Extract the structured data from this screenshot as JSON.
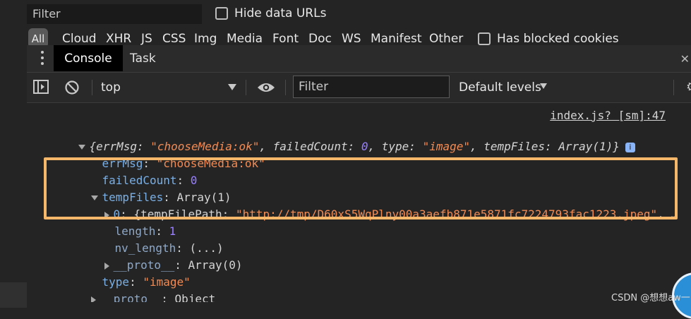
{
  "network": {
    "filter_placeholder": "Filter",
    "hide_data_urls_label": "Hide data URLs",
    "all_label": "All",
    "types": [
      "Cloud",
      "XHR",
      "JS",
      "CSS",
      "Img",
      "Media",
      "Font",
      "Doc",
      "WS",
      "Manifest",
      "Other"
    ],
    "blocked_cookies_label": "Has blocked cookies"
  },
  "tabs": {
    "console_label": "Console",
    "task_label": "Task"
  },
  "toolbar": {
    "context": "top",
    "filter_placeholder": "Filter",
    "levels_label": "Default levels"
  },
  "console": {
    "source_link": "index.js? [sm]:47",
    "lines": {
      "summary_open": "{",
      "summary_k1": "errMsg",
      "summary_v1": "\"chooseMedia:ok\"",
      "summary_k2": "failedCount",
      "summary_v2": "0",
      "summary_k3": "type",
      "summary_v3": "\"image\"",
      "summary_k4": "tempFiles",
      "summary_v4": "Array(1)",
      "summary_close": "}",
      "errMsg_key": "errMsg",
      "errMsg_val": "\"chooseMedia:ok\"",
      "failedCount_key": "failedCount",
      "failedCount_val": "0",
      "tempFiles_key": "tempFiles",
      "tempFiles_val": "Array(1)",
      "item0_key": "0",
      "item0_prefix": "{tempFilePath: ",
      "item0_val": "\"http://tmp/D60xS5WqPlny00a3aefb871e5871fc7224793fac1223.jpeg\"",
      "item0_more": ", …",
      "length_key": "length",
      "length_val": "1",
      "nvlength_key": "nv_length",
      "nvlength_val": "(...)",
      "proto_arr_key": "__proto__",
      "proto_arr_val": "Array(0)",
      "type_key": "type",
      "type_val": "\"image\"",
      "proto_obj_key": "__proto__",
      "proto_obj_val": "Object"
    }
  },
  "watermark": "CSDN @想想aw一",
  "colors": {
    "highlight": "#f5b86a",
    "string": "#f28b54",
    "number": "#9980ff",
    "key": "#7ab0e6"
  }
}
